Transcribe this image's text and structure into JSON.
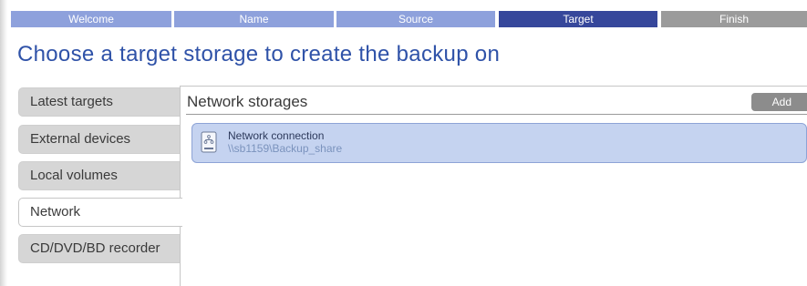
{
  "wizard_steps": [
    {
      "label": "Welcome",
      "state": "done"
    },
    {
      "label": "Name",
      "state": "done"
    },
    {
      "label": "Source",
      "state": "done"
    },
    {
      "label": "Target",
      "state": "active"
    },
    {
      "label": "Finish",
      "state": "future"
    }
  ],
  "page_title": "Choose a target storage to create the backup on",
  "target_tabs": [
    {
      "label": "Latest targets"
    },
    {
      "label": "External devices"
    },
    {
      "label": "Local volumes"
    },
    {
      "label": "Network",
      "selected": true
    },
    {
      "label": "CD/DVD/BD recorder"
    }
  ],
  "panel": {
    "title": "Network storages",
    "add_label": "Add",
    "items": [
      {
        "name": "Network connection",
        "path": "\\\\sb1159\\Backup_share",
        "icon": "network-drive-icon",
        "selected": true
      }
    ]
  },
  "colors": {
    "step_done": "#8ea1dc",
    "step_active": "#36479b",
    "step_future": "#9b9b9b",
    "title": "#2f52a8",
    "item_selected_bg": "#c5d3f0",
    "item_selected_border": "#8da3d6"
  }
}
